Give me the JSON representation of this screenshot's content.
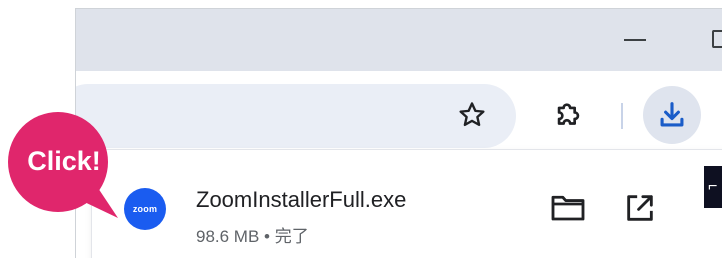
{
  "callout": {
    "text": "Click!",
    "color": "#e0266c"
  },
  "toolbar": {
    "bookmark_icon": "star-icon",
    "extensions_icon": "puzzle-icon",
    "download_icon": "download-icon",
    "download_accent": "#1a5cc8"
  },
  "download_item": {
    "app_icon": "zoom",
    "file_name": "ZoomInstallerFull.exe",
    "meta": "98.6 MB • 完了",
    "folder_icon": "folder-icon",
    "open_icon": "open-external-icon"
  },
  "edge_glyph": "⌐"
}
